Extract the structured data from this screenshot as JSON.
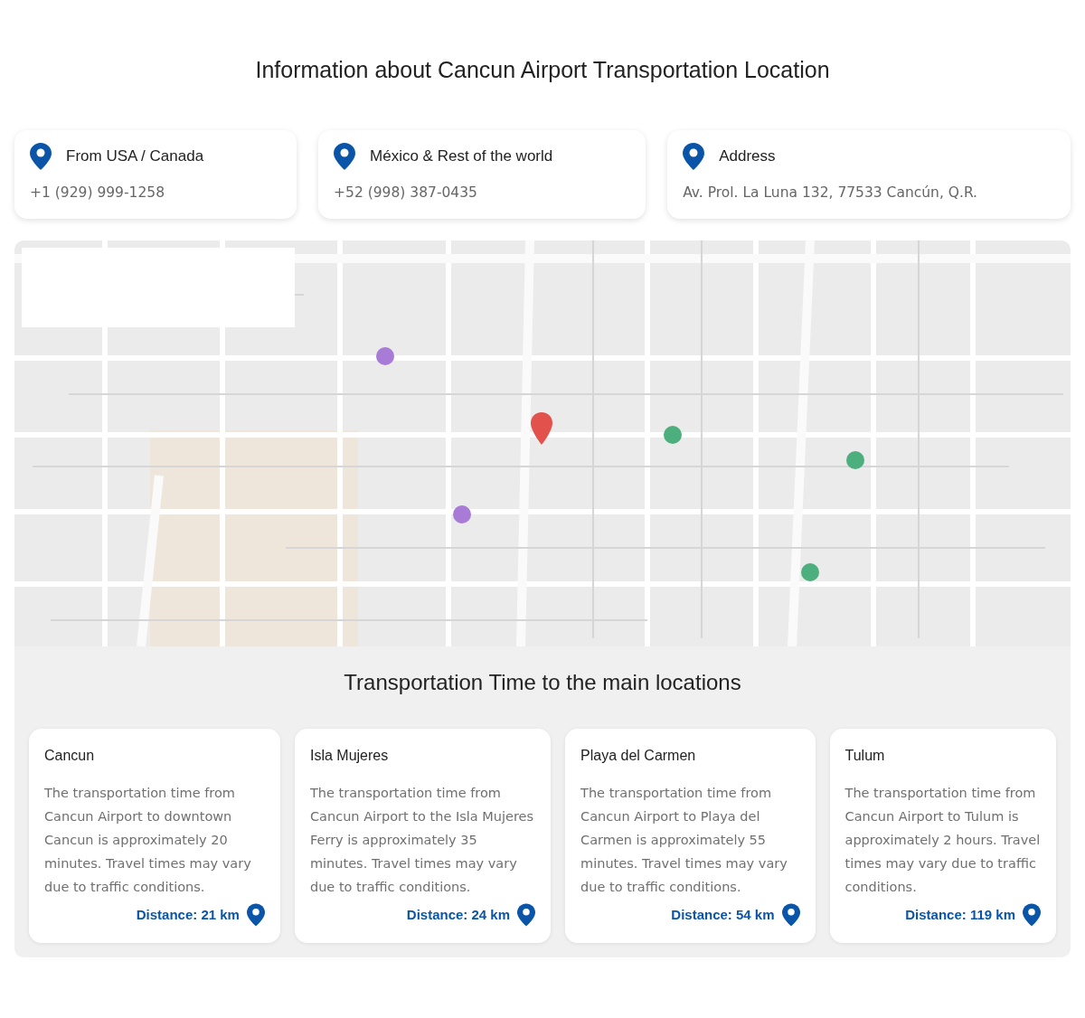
{
  "title": "Information about Cancun Airport Transportation Location",
  "contacts": [
    {
      "label": "From USA / Canada",
      "value": "+1 (929) 999-1258"
    },
    {
      "label": "México & Rest of the world",
      "value": "+52 (998) 387-0435"
    },
    {
      "label": "Address",
      "value": "Av. Prol. La Luna 132, 77533 Cancún, Q.R."
    }
  ],
  "times": {
    "title": "Transportation Time to the main locations",
    "cards": [
      {
        "title": "Cancun",
        "text": "The transportation time from Cancun Airport to downtown Cancun is approximately 20 minutes. Travel times may vary due to traffic conditions.",
        "distance": "Distance: 21 km"
      },
      {
        "title": "Isla Mujeres",
        "text": "The transportation time from Cancun Airport to the Isla Mujeres Ferry is approximately 35 minutes. Travel times may vary due to traffic conditions.",
        "distance": "Distance: 24 km"
      },
      {
        "title": "Playa del Carmen",
        "text": "The transportation time from Cancun Airport to Playa del Carmen is approximately 55 minutes. Travel times may vary due to traffic conditions.",
        "distance": "Distance: 54 km"
      },
      {
        "title": "Tulum",
        "text": "The transportation time from Cancun Airport to Tulum is approximately 2 hours. Travel times may vary due to traffic conditions.",
        "distance": "Distance: 119 km"
      }
    ]
  }
}
